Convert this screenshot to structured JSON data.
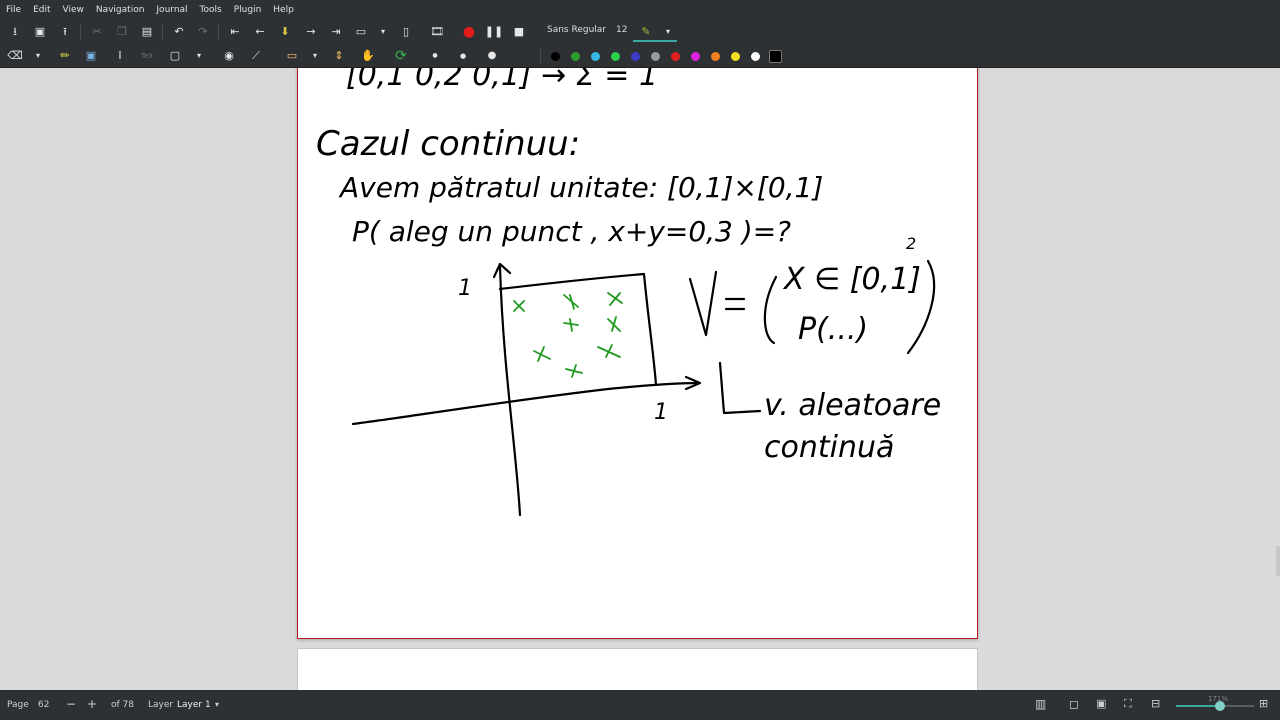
{
  "menu": [
    "File",
    "Edit",
    "View",
    "Navigation",
    "Journal",
    "Tools",
    "Plugin",
    "Help"
  ],
  "toolbar": {
    "font_name": "Sans Regular",
    "font_size": "12"
  },
  "colors": {
    "palette": [
      "#000000",
      "#2a9d2a",
      "#36b8e6",
      "#2ad24a",
      "#3c3cc8",
      "#9a9a9a",
      "#e02020",
      "#e020e0",
      "#f08020",
      "#f0e020",
      "#ffffff",
      "#000000"
    ],
    "ink_black": "#000000",
    "ink_green": "#1f9a1f",
    "page_border": "#b51f1f",
    "ui_dark": "#2e3134"
  },
  "status": {
    "page_label": "Page",
    "page_value": "62",
    "of_pages": "of 78",
    "layer_label": "Layer",
    "layer_value": "Layer 1",
    "zoom_text": "171%",
    "zoom_fraction": 0.57
  },
  "handwriting": {
    "line_top": "[0,1  0,2  0,1] → Σ = 1",
    "heading": "Cazul continuu:",
    "line1": "Avem pătratul unitate: [0,1]×[0,1]",
    "line2": "P( aleg un punct , x+y=0,3 )=?",
    "axis_y_label": "1",
    "axis_x_label": "1",
    "v_def_1": "X ∈ [0,1]",
    "v_def_exp": "2",
    "v_def_2": "P(...)",
    "v_prefix": "V =",
    "arrow_note_1": "v. aleatoare",
    "arrow_note_2": "continuă"
  }
}
